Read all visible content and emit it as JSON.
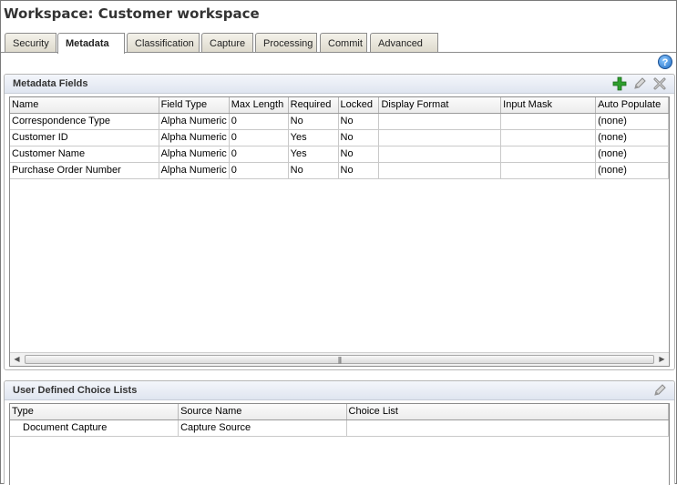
{
  "window": {
    "title": "Workspace: Customer workspace"
  },
  "tabs": [
    {
      "label": "Security",
      "active": false
    },
    {
      "label": "Metadata",
      "active": true
    },
    {
      "label": "Classification",
      "active": false
    },
    {
      "label": "Capture",
      "active": false
    },
    {
      "label": "Processing",
      "active": false
    },
    {
      "label": "Commit",
      "active": false
    },
    {
      "label": "Advanced",
      "active": false
    }
  ],
  "help": {
    "label": "?"
  },
  "metadata_panel": {
    "title": "Metadata Fields",
    "columns": [
      "Name",
      "Field Type",
      "Max Length",
      "Required",
      "Locked",
      "Display Format",
      "Input Mask",
      "Auto Populate"
    ],
    "rows": [
      [
        "Correspondence Type",
        "Alpha Numeric",
        "0",
        "No",
        "No",
        "",
        "",
        "(none)"
      ],
      [
        "Customer ID",
        "Alpha Numeric",
        "0",
        "Yes",
        "No",
        "",
        "",
        "(none)"
      ],
      [
        "Customer Name",
        "Alpha Numeric",
        "0",
        "Yes",
        "No",
        "",
        "",
        "(none)"
      ],
      [
        "Purchase Order Number",
        "Alpha Numeric",
        "0",
        "No",
        "No",
        "",
        "",
        "(none)"
      ]
    ],
    "icons": [
      "add-icon",
      "edit-icon",
      "delete-icon"
    ]
  },
  "choice_panel": {
    "title": "User Defined Choice Lists",
    "columns": [
      "Type",
      "Source Name",
      "Choice List"
    ],
    "rows": [
      [
        "Document Capture",
        "Capture Source",
        ""
      ]
    ],
    "icons": [
      "edit-icon"
    ]
  },
  "colors": {
    "add_green": "#2e9e2e",
    "help_blue": "#1f6cc4",
    "header_bg": "#dfe5f0"
  }
}
